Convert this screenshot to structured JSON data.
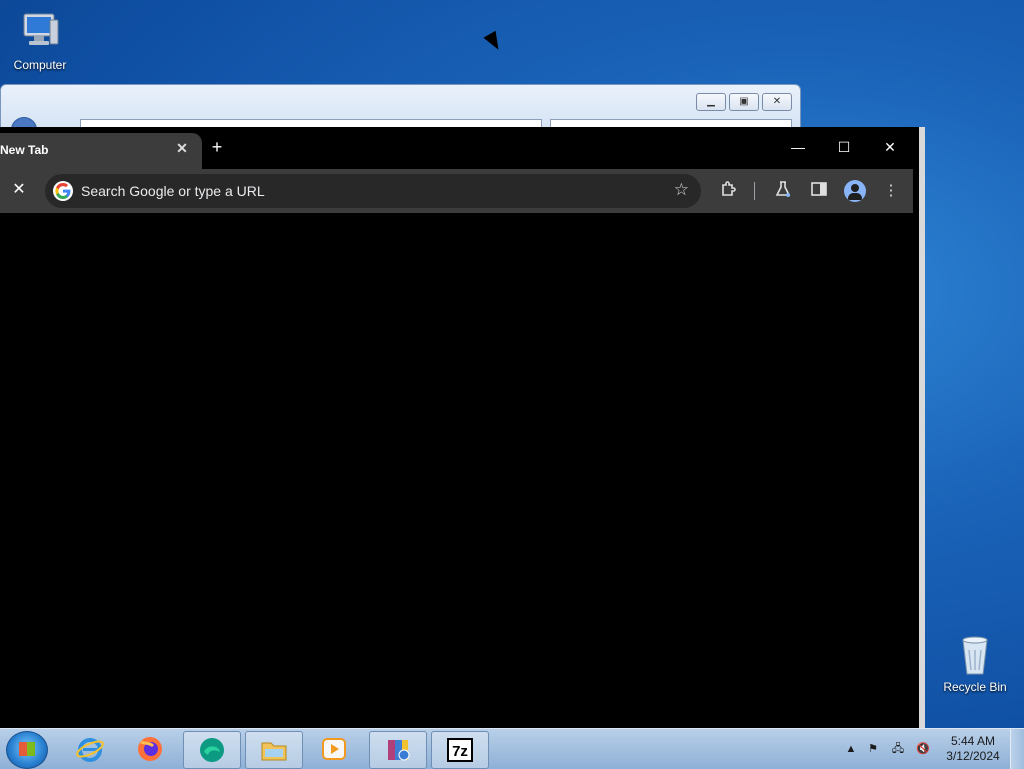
{
  "desktop": {
    "icons": [
      {
        "label": "Computer",
        "icon": "computer-icon"
      },
      {
        "label": "Recycle Bin",
        "icon": "recycle-bin-icon"
      }
    ]
  },
  "explorer": {
    "address": "",
    "search_placeholder": ""
  },
  "chrome": {
    "tab_title": "New Tab",
    "tab_close": "✕",
    "new_tab_symbol": "+",
    "omnibox_placeholder": "Search Google or type a URL",
    "window_controls": {
      "minimize": "—",
      "maximize": "☐",
      "close": "✕"
    }
  },
  "taskbar": {
    "items": [
      "internet-explorer",
      "firefox",
      "edge",
      "file-explorer",
      "media-player",
      "winrar",
      "7zip"
    ],
    "active_item": "7zip",
    "clock_time": "5:44 AM",
    "clock_date": "3/12/2024"
  }
}
